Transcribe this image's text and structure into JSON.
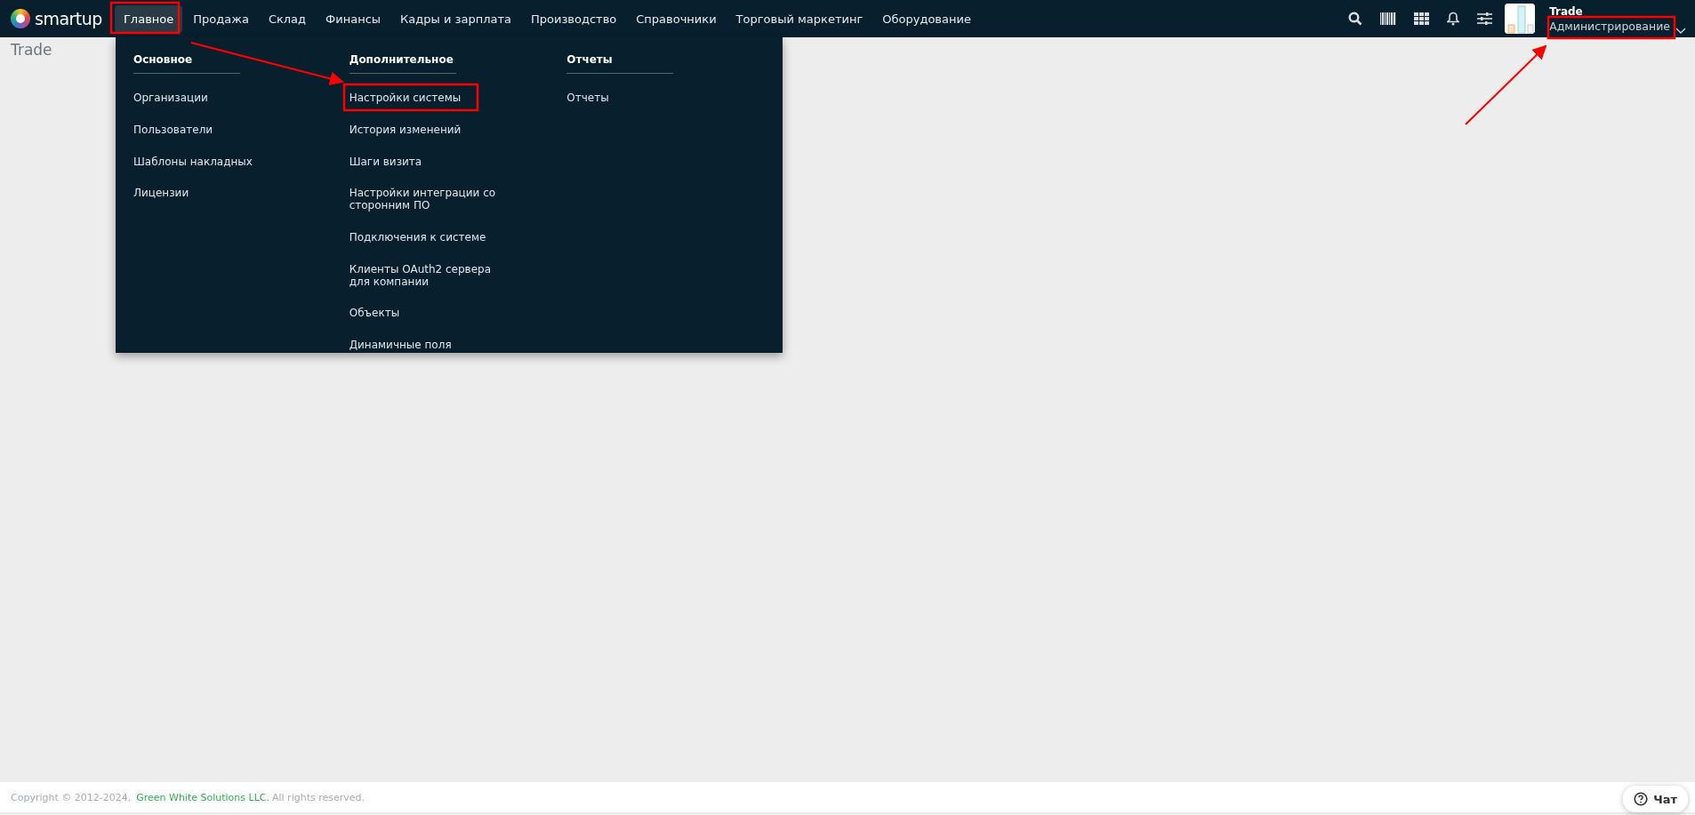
{
  "brand": {
    "name": "smartup"
  },
  "nav": [
    {
      "label": "Главное",
      "selected": true
    },
    {
      "label": "Продажа",
      "selected": false
    },
    {
      "label": "Склад",
      "selected": false
    },
    {
      "label": "Финансы",
      "selected": false
    },
    {
      "label": "Кадры и зарплата",
      "selected": false
    },
    {
      "label": "Производство",
      "selected": false
    },
    {
      "label": "Справочники",
      "selected": false
    },
    {
      "label": "Торговый маркетинг",
      "selected": false
    },
    {
      "label": "Оборудование",
      "selected": false
    }
  ],
  "account": {
    "company": "Trade",
    "role": "Администрирование"
  },
  "page_title": "Trade",
  "mega_menu": {
    "columns": [
      {
        "heading": "Основное",
        "items": [
          "Организации",
          "Пользователи",
          "Шаблоны накладных",
          "Лицензии"
        ]
      },
      {
        "heading": "Дополнительное",
        "items": [
          "Настройки системы",
          "История изменений",
          "Шаги визита",
          "Настройки интеграции со сторонним ПО",
          "Подключения к системе",
          "Клиенты OAuth2 сервера для компании",
          "Объекты",
          "Динамичные поля"
        ]
      },
      {
        "heading": "Отчеты",
        "items": [
          "Отчеты"
        ]
      }
    ]
  },
  "footer": {
    "copyright": "Copyright © 2012-2024,",
    "company_link": "Green White Solutions LLC.",
    "rights": "All rights reserved."
  },
  "chat_button": {
    "label": "Чат"
  }
}
